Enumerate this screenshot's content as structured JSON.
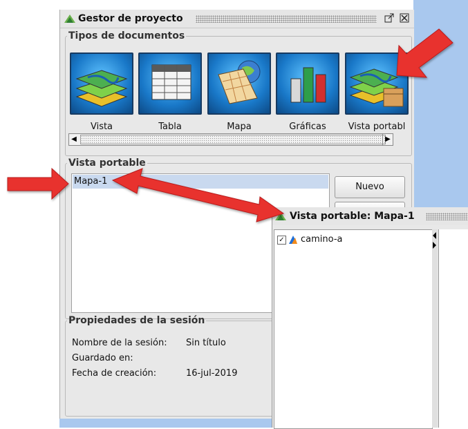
{
  "project_manager": {
    "title": "Gestor de proyecto",
    "doc_types_legend": "Tipos de documentos",
    "doc_types": [
      {
        "label": "Vista",
        "icon": "layers-icon"
      },
      {
        "label": "Tabla",
        "icon": "table-icon"
      },
      {
        "label": "Mapa",
        "icon": "map-icon"
      },
      {
        "label": "Gráficas",
        "icon": "bar-chart-icon"
      },
      {
        "label": "Vista portabl",
        "icon": "portable-view-icon"
      }
    ],
    "list_legend": "Vista portable",
    "list_items": [
      "Mapa-1"
    ],
    "new_button": "Nuevo",
    "session_legend": "Propiedades de la sesión",
    "session": {
      "name_label": "Nombre de la sesión:",
      "name_value": "Sin título",
      "saved_label": "Guardado en:",
      "saved_value": "",
      "created_label": "Fecha de creación:",
      "created_value": "16-jul-2019"
    }
  },
  "portable_view": {
    "title": "Vista portable: Mapa-1",
    "layers": [
      {
        "name": "camino-a",
        "checked": true
      }
    ]
  },
  "colors": {
    "accent_blue": "#a9c8ee",
    "arrow_red": "#e8312f",
    "selection": "#c9d9ef"
  }
}
